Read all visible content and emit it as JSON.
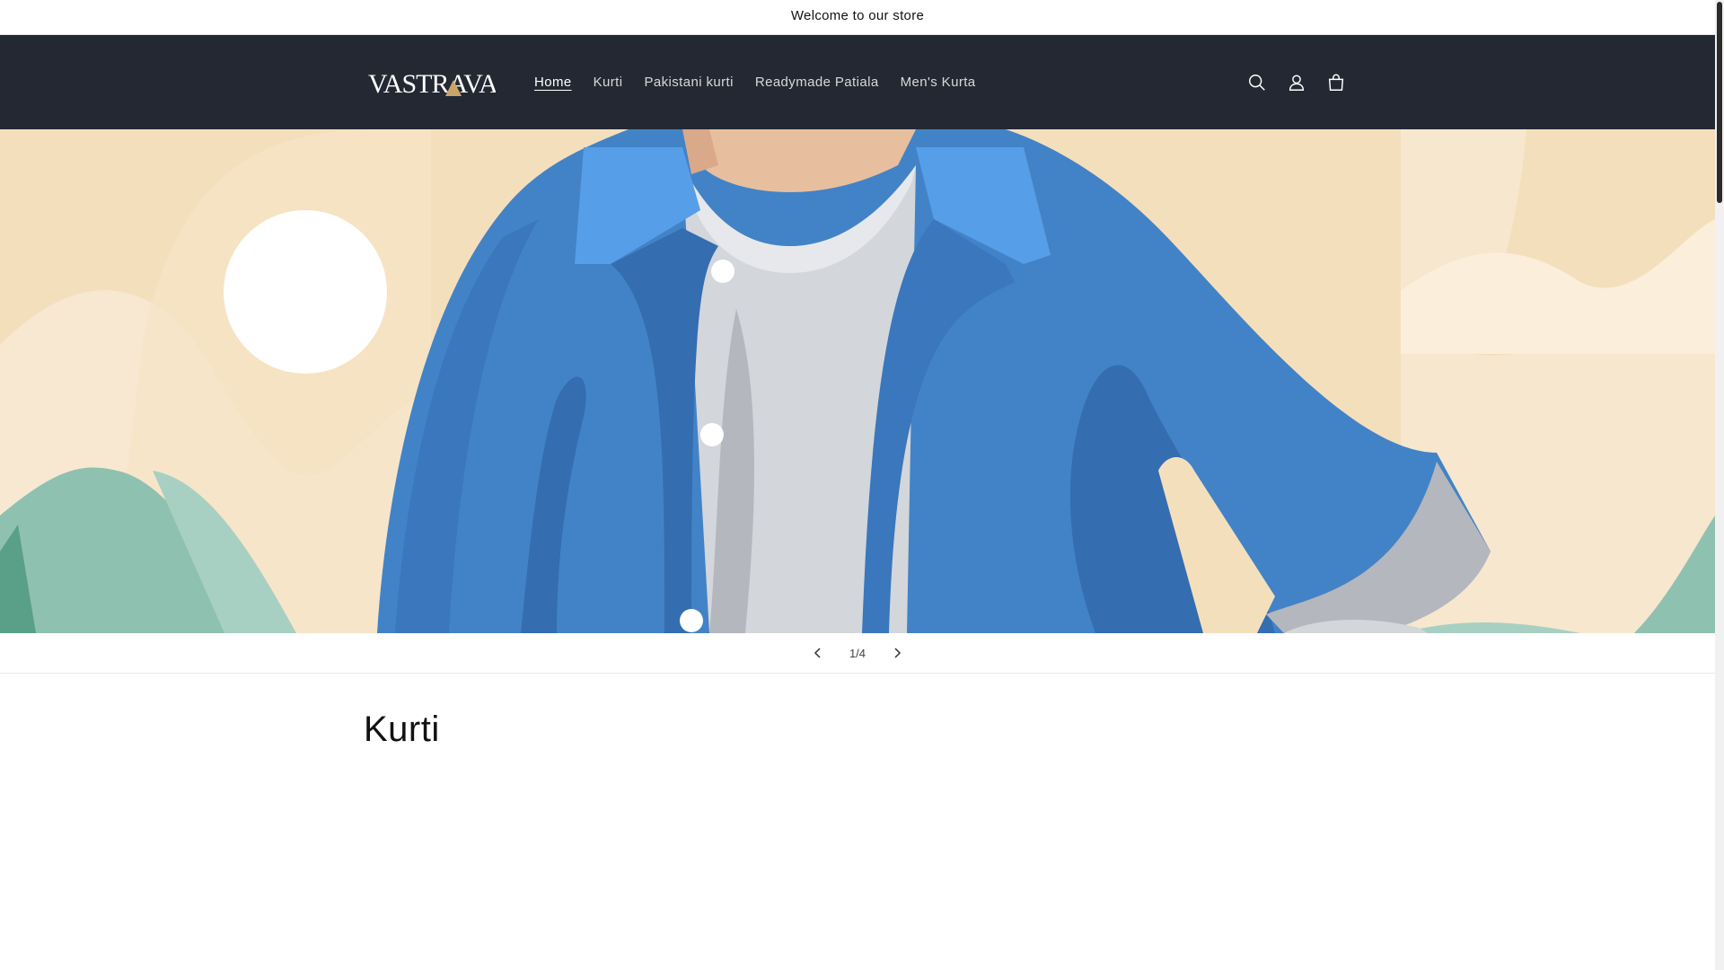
{
  "announcement": {
    "text": "Welcome to our store"
  },
  "header": {
    "logo_text": "VASTRAVA",
    "nav": [
      {
        "label": "Home",
        "active": true
      },
      {
        "label": "Kurti",
        "active": false
      },
      {
        "label": "Pakistani kurti",
        "active": false
      },
      {
        "label": "Readymade Patiala",
        "active": false
      },
      {
        "label": "Men's Kurta",
        "active": false
      }
    ],
    "icons": [
      "search-icon",
      "account-icon",
      "cart-icon"
    ]
  },
  "slideshow": {
    "counter": "1/4",
    "total": 4,
    "current": 1
  },
  "section": {
    "title": "Kurti"
  },
  "colors": {
    "header_bg": "#242833",
    "banner_sand": "#f4dfbd",
    "jacket_blue": "#4283c7",
    "jacket_dark": "#346db0",
    "mint": "#8fc1b0"
  }
}
